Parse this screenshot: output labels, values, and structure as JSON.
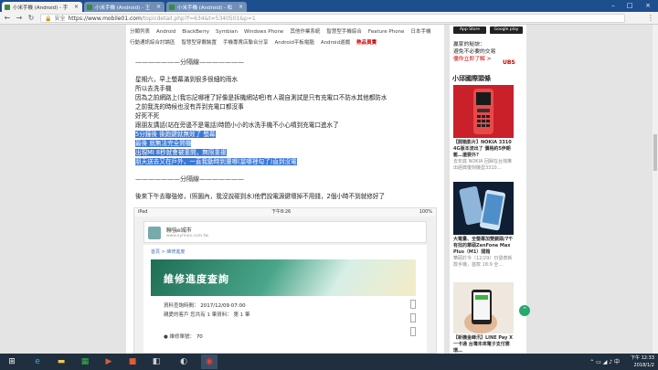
{
  "tabs": [
    {
      "title": "小米手機 (Android) - 手",
      "active": true
    },
    {
      "title": "小米手機 (Android) - 王",
      "active": false
    },
    {
      "title": "小米手機 (Android) - 松",
      "active": false
    }
  ],
  "address": {
    "secure_label": "安全",
    "host": "https://www.mobile01.com",
    "path": "/topicdetail.php?f=634&t=5340501&p=1"
  },
  "topnav": {
    "row1": [
      "分類列表",
      "Android",
      "BlackBerry",
      "Symbian",
      "Windows Phone",
      "其他作業系統",
      "智慧型手機綜合",
      "Feature Phone",
      "日本手機"
    ],
    "row2": [
      "行動通訊綜合討論區",
      "智慧型穿戴裝置",
      "手機專賣店聯合分享",
      "Android平板電腦",
      "Android遊戲"
    ],
    "hot": "熱品買賣"
  },
  "article": {
    "separator1": "———————分隔線———————",
    "lines": [
      "星期六，早上螢幕滿到很多很細的雨水",
      "所以去洗手機",
      "因為之前網路上(我忘記哪裡了好像是拆機網站吧)有人親自測試是只有充電口不防水其他都防水",
      "之前我洗的時候也沒有弄到充電口都沒事",
      "好死不死",
      "跟朋友講話(站在旁邊不是電話)時間小小的水洗手機不小心噴到充電口進水了"
    ],
    "highlighted": [
      "5分鐘後 後跑鍵就無效了 螢幕",
      "最後 就無法完全開機",
      "出現MI 8秒就會被重開，無限重複",
      "朋天送去又在戶外，一直我動時到還哪(當哪裡勾了)直到沒電"
    ],
    "separator2": "———————分隔線———————",
    "after": "後來下午去聯強修，(照圖內，我沒說碰到水)他們說電源鍵壞掉不用錢，2個小時不到就修好了"
  },
  "screenshot": {
    "status_left": "iPad",
    "status_time": "下午8:26",
    "status_right": "100%",
    "site_title": "聯強e城市",
    "site_sub": "www.synnex.com.tw",
    "breadcrumb": "首頁 > 維修進度",
    "banner_title": "維修進度查詢",
    "line1_label": "資料查詢時間：",
    "line1_value": "2017/12/09 07:00",
    "line2": "親愛的客戶 您共有 1 筆資料：  第 1 筆",
    "line3_label": "● 維修單號：",
    "line3_value": "70"
  },
  "right_column": {
    "badge1": "App Store",
    "badge2": "Google play",
    "ad_line1": "贏家的秘訣：",
    "ad_line2": "避免不必要的交易",
    "ad_link": "優你立即了解 >",
    "ad_brand": "UBS",
    "heading": "小邱國際頭條",
    "items": [
      {
        "title": "【開箱影片】NOKIA 3310 4G版本流出了 價格約5伊朗籃…還要外?",
        "meta": "去年底 NOKIA 回歸在台灣推出經典復刻機型3310…"
      },
      {
        "title": "大電量、全螢幕加雙鏡頭/7千有找的華碩ZenFone Max Plus（M1）開箱",
        "meta": "華碩於今（12/29）日發表新款手機，首款 18:9 全…"
      },
      {
        "title": "【新機金峰汛】LINE Pay X 一卡通 台灣未來電子支付需環…",
        "meta": ""
      }
    ]
  },
  "taskbar": {
    "time": "下午 12:33",
    "date": "2018/1/2"
  },
  "colors": {
    "tabbar": "#1d4f8f",
    "highlight": "#3b78d8",
    "taskbar": "#1f2f3f",
    "accent_green": "#27a86c"
  }
}
